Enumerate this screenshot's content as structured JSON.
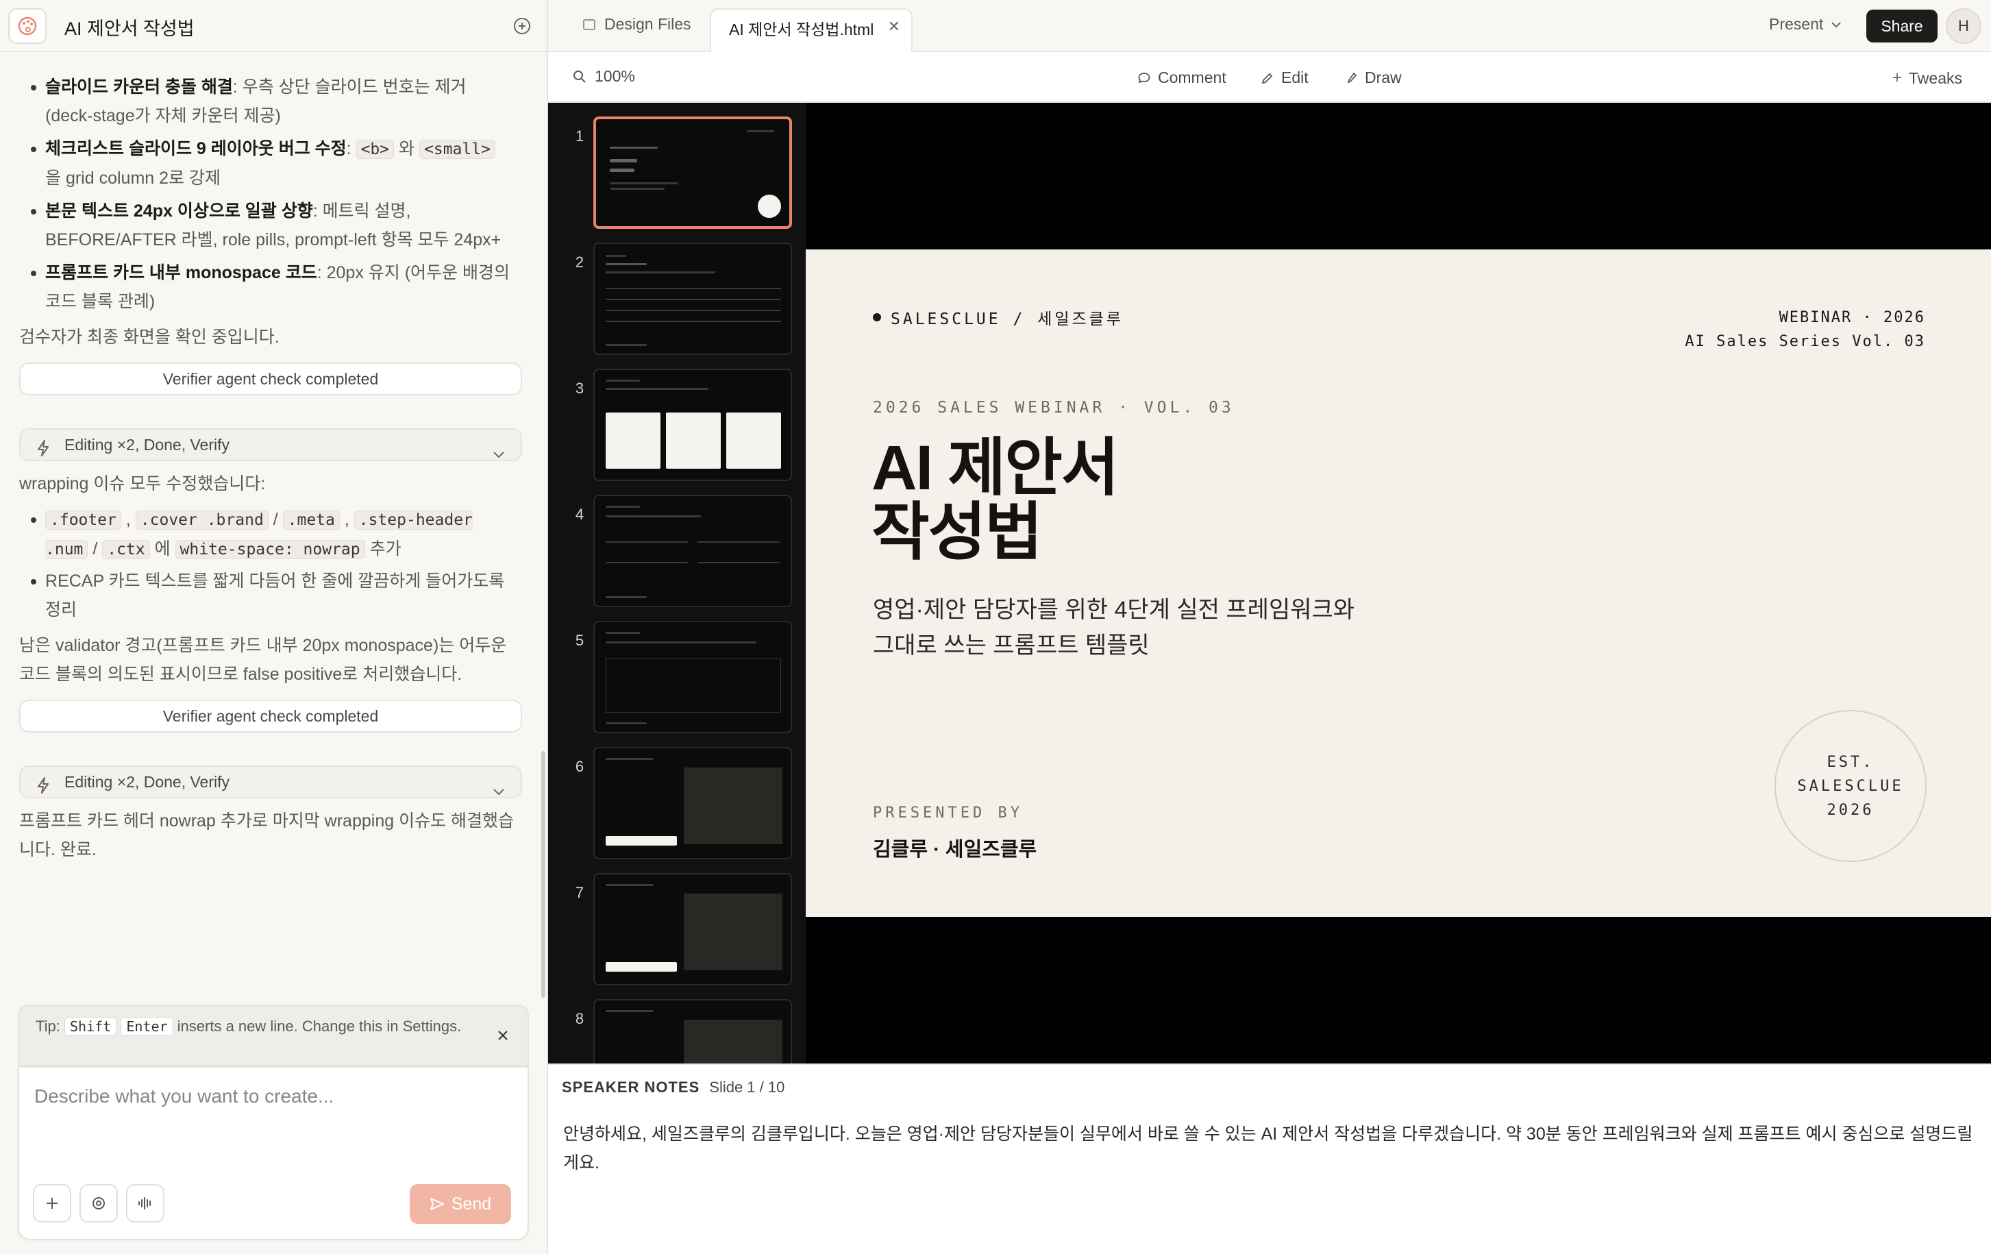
{
  "left_panel": {
    "title": "AI 제안서 작성법",
    "bullets_a": [
      {
        "bold": "슬라이드 카운터 충돌 해결",
        "rest": ": 우측 상단 슬라이드 번호는 제거 (deck-stage가 자체 카운터 제공)"
      },
      {
        "bold": "체크리스트 슬라이드 9 레이아웃 버그 수정",
        "rest_pre": ": ",
        "code1": "<b>",
        "mid": " 와 ",
        "code2": "<small>",
        "rest": " 을 grid column 2로 강제"
      },
      {
        "bold": "본문 텍스트 24px 이상으로 일괄 상향",
        "rest": ": 메트릭 설명, BEFORE/AFTER 라벨, role pills, prompt-left 항목 모두 24px+"
      },
      {
        "bold": "프롬프트 카드 내부 monospace 코드",
        "rest": ": 20px 유지 (어두운 배경의 코드 블록 관례)"
      }
    ],
    "para_1": "검수자가 최종 화면을 확인 중입니다.",
    "verifier_1": "Verifier agent check completed",
    "editing_1": "Editing ×2, Done, Verify",
    "para_2": "wrapping 이슈 모두 수정했습니다:",
    "bullets_b": {
      "b1_code1": ".footer",
      "b1_sep1": " , ",
      "b1_code2": ".cover .brand",
      "b1_sep2": " / ",
      "b1_code3": ".meta",
      "b1_sep3": " , ",
      "b1_code4": ".step-header .num",
      "b1_sep4": " / ",
      "b1_code5": ".ctx",
      "b1_mid": " 에 ",
      "b1_code6": "white-space: nowrap",
      "b1_end": " 추가",
      "b2": "RECAP 카드 텍스트를 짧게 다듬어 한 줄에 깔끔하게 들어가도록 정리"
    },
    "para_3": "남은 validator 경고(프롬프트 카드 내부 20px monospace)는 어두운 코드 블록의 의도된 표시이므로 false positive로 처리했습니다.",
    "verifier_2": "Verifier agent check completed",
    "editing_2": "Editing ×2, Done, Verify",
    "para_4": "프롬프트 카드 헤더 nowrap 추가로 마지막 wrapping 이슈도 해결했습니다. 완료.",
    "tip": {
      "prefix": "Tip:",
      "key1": "Shift",
      "key2": "Enter",
      "suffix": "inserts a new line. Change this in Settings."
    },
    "composer": {
      "placeholder": "Describe what you want to create...",
      "send": "Send"
    }
  },
  "tabs": {
    "design_files": "Design Files",
    "active": "AI 제안서 작성법.html",
    "present": "Present",
    "share": "Share",
    "avatar": "H"
  },
  "toolbar": {
    "zoom": "100%",
    "comment": "Comment",
    "edit": "Edit",
    "draw": "Draw",
    "tweaks": "Tweaks"
  },
  "thumbnails": {
    "numbers": [
      "1",
      "2",
      "3",
      "4",
      "5",
      "6",
      "7",
      "8"
    ],
    "selected": "1"
  },
  "slide": {
    "brand": "SALESCLUE / 세일즈클루",
    "meta_line1": "WEBINAR · 2026",
    "meta_line2": "AI Sales Series Vol. 03",
    "kicker": "2026 SALES WEBINAR · VOL. 03",
    "title_line1": "AI 제안서",
    "title_line2": "작성법",
    "subtitle_line1": "영업·제안 담당자를 위한 4단계 실전 프레임워크와",
    "subtitle_line2": "그대로 쓰는 프롬프트 템플릿",
    "presented_by": "PRESENTED BY",
    "presenter": "김클루 · 세일즈클루",
    "seal_line1": "EST.",
    "seal_line2": "SALESCLUE",
    "seal_line3": "2026"
  },
  "notes": {
    "label": "SPEAKER NOTES",
    "counter": "Slide 1 / 10",
    "text": "안녕하세요, 세일즈클루의 김클루입니다. 오늘은 영업·제안 담당자분들이 실무에서 바로 쓸 수 있는 AI 제안서 작성법을 다루겠습니다. 약 30분 동안 프레임워크와 실제 프롬프트 예시 중심으로 설명드릴게요."
  },
  "colors": {
    "accent": "#e8856a",
    "send_disabled": "#f2b7a4",
    "slide_bg": "#f5f1ea",
    "stage_bg": "#000000"
  }
}
